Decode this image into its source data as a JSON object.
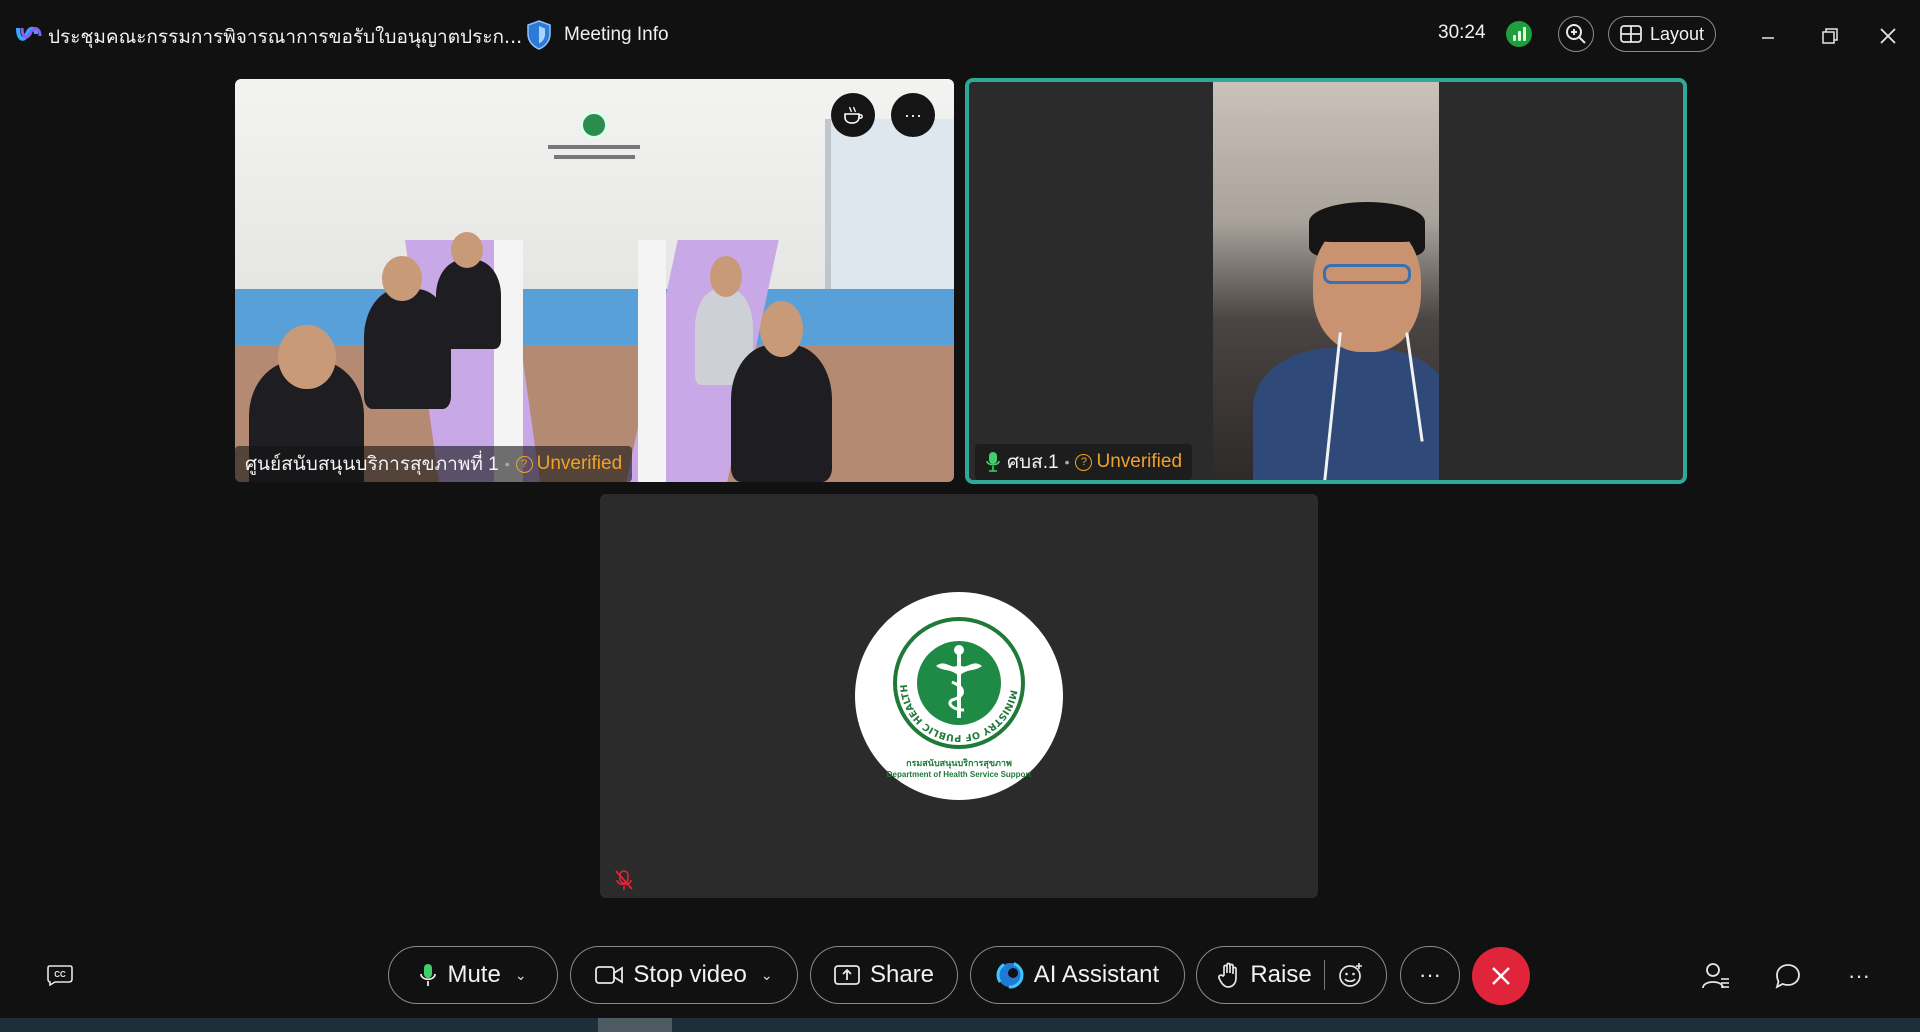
{
  "window": {
    "meeting_title": "ประชุมคณะกรรมการพิจารณาการขอรับใบอนุญาตประก...",
    "meeting_info_label": "Meeting Info",
    "timer": "30:24",
    "layout_label": "Layout"
  },
  "tiles": [
    {
      "name": "ศูนย์สนับสนุนบริการสุขภาพที่ 1",
      "status": "Unverified"
    },
    {
      "name": "ศบส.1",
      "status": "Unverified"
    },
    {
      "logo_caption_th": "กรมสนับสนุนบริการสุขภาพ",
      "logo_caption_en": "Department of Health Service Support",
      "logo_ring_text": "MINISTRY OF PUBLIC HEALTH"
    }
  ],
  "toolbar": {
    "mute_label": "Mute",
    "stop_video_label": "Stop video",
    "share_label": "Share",
    "ai_assistant_label": "AI Assistant",
    "raise_label": "Raise",
    "more_label": "···"
  },
  "colors": {
    "background": "#111111",
    "active_speaker_border": "#2fa89a",
    "unverified": "#f0a12b",
    "end_call": "#e0243a",
    "signal": "#1e9e3c"
  }
}
